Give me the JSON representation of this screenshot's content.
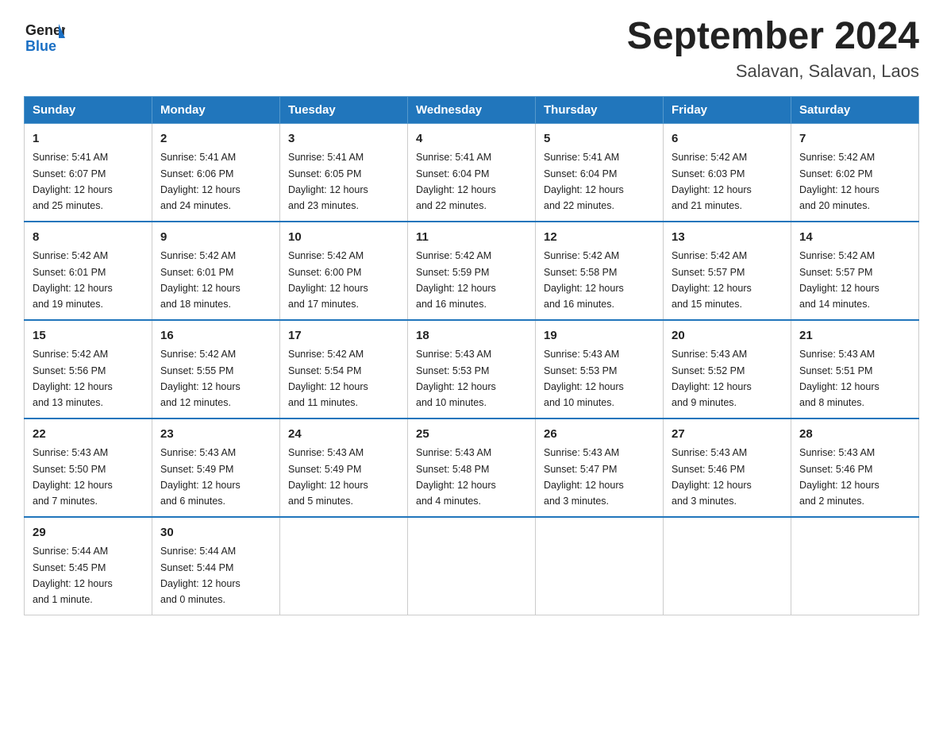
{
  "logo": {
    "text_general": "General",
    "text_blue": "Blue"
  },
  "title": "September 2024",
  "subtitle": "Salavan, Salavan, Laos",
  "days_of_week": [
    "Sunday",
    "Monday",
    "Tuesday",
    "Wednesday",
    "Thursday",
    "Friday",
    "Saturday"
  ],
  "weeks": [
    [
      {
        "day": "1",
        "sunrise": "5:41 AM",
        "sunset": "6:07 PM",
        "daylight": "12 hours and 25 minutes."
      },
      {
        "day": "2",
        "sunrise": "5:41 AM",
        "sunset": "6:06 PM",
        "daylight": "12 hours and 24 minutes."
      },
      {
        "day": "3",
        "sunrise": "5:41 AM",
        "sunset": "6:05 PM",
        "daylight": "12 hours and 23 minutes."
      },
      {
        "day": "4",
        "sunrise": "5:41 AM",
        "sunset": "6:04 PM",
        "daylight": "12 hours and 22 minutes."
      },
      {
        "day": "5",
        "sunrise": "5:41 AM",
        "sunset": "6:04 PM",
        "daylight": "12 hours and 22 minutes."
      },
      {
        "day": "6",
        "sunrise": "5:42 AM",
        "sunset": "6:03 PM",
        "daylight": "12 hours and 21 minutes."
      },
      {
        "day": "7",
        "sunrise": "5:42 AM",
        "sunset": "6:02 PM",
        "daylight": "12 hours and 20 minutes."
      }
    ],
    [
      {
        "day": "8",
        "sunrise": "5:42 AM",
        "sunset": "6:01 PM",
        "daylight": "12 hours and 19 minutes."
      },
      {
        "day": "9",
        "sunrise": "5:42 AM",
        "sunset": "6:01 PM",
        "daylight": "12 hours and 18 minutes."
      },
      {
        "day": "10",
        "sunrise": "5:42 AM",
        "sunset": "6:00 PM",
        "daylight": "12 hours and 17 minutes."
      },
      {
        "day": "11",
        "sunrise": "5:42 AM",
        "sunset": "5:59 PM",
        "daylight": "12 hours and 16 minutes."
      },
      {
        "day": "12",
        "sunrise": "5:42 AM",
        "sunset": "5:58 PM",
        "daylight": "12 hours and 16 minutes."
      },
      {
        "day": "13",
        "sunrise": "5:42 AM",
        "sunset": "5:57 PM",
        "daylight": "12 hours and 15 minutes."
      },
      {
        "day": "14",
        "sunrise": "5:42 AM",
        "sunset": "5:57 PM",
        "daylight": "12 hours and 14 minutes."
      }
    ],
    [
      {
        "day": "15",
        "sunrise": "5:42 AM",
        "sunset": "5:56 PM",
        "daylight": "12 hours and 13 minutes."
      },
      {
        "day": "16",
        "sunrise": "5:42 AM",
        "sunset": "5:55 PM",
        "daylight": "12 hours and 12 minutes."
      },
      {
        "day": "17",
        "sunrise": "5:42 AM",
        "sunset": "5:54 PM",
        "daylight": "12 hours and 11 minutes."
      },
      {
        "day": "18",
        "sunrise": "5:43 AM",
        "sunset": "5:53 PM",
        "daylight": "12 hours and 10 minutes."
      },
      {
        "day": "19",
        "sunrise": "5:43 AM",
        "sunset": "5:53 PM",
        "daylight": "12 hours and 10 minutes."
      },
      {
        "day": "20",
        "sunrise": "5:43 AM",
        "sunset": "5:52 PM",
        "daylight": "12 hours and 9 minutes."
      },
      {
        "day": "21",
        "sunrise": "5:43 AM",
        "sunset": "5:51 PM",
        "daylight": "12 hours and 8 minutes."
      }
    ],
    [
      {
        "day": "22",
        "sunrise": "5:43 AM",
        "sunset": "5:50 PM",
        "daylight": "12 hours and 7 minutes."
      },
      {
        "day": "23",
        "sunrise": "5:43 AM",
        "sunset": "5:49 PM",
        "daylight": "12 hours and 6 minutes."
      },
      {
        "day": "24",
        "sunrise": "5:43 AM",
        "sunset": "5:49 PM",
        "daylight": "12 hours and 5 minutes."
      },
      {
        "day": "25",
        "sunrise": "5:43 AM",
        "sunset": "5:48 PM",
        "daylight": "12 hours and 4 minutes."
      },
      {
        "day": "26",
        "sunrise": "5:43 AM",
        "sunset": "5:47 PM",
        "daylight": "12 hours and 3 minutes."
      },
      {
        "day": "27",
        "sunrise": "5:43 AM",
        "sunset": "5:46 PM",
        "daylight": "12 hours and 3 minutes."
      },
      {
        "day": "28",
        "sunrise": "5:43 AM",
        "sunset": "5:46 PM",
        "daylight": "12 hours and 2 minutes."
      }
    ],
    [
      {
        "day": "29",
        "sunrise": "5:44 AM",
        "sunset": "5:45 PM",
        "daylight": "12 hours and 1 minute."
      },
      {
        "day": "30",
        "sunrise": "5:44 AM",
        "sunset": "5:44 PM",
        "daylight": "12 hours and 0 minutes."
      },
      null,
      null,
      null,
      null,
      null
    ]
  ],
  "labels": {
    "sunrise": "Sunrise:",
    "sunset": "Sunset:",
    "daylight": "Daylight:"
  }
}
